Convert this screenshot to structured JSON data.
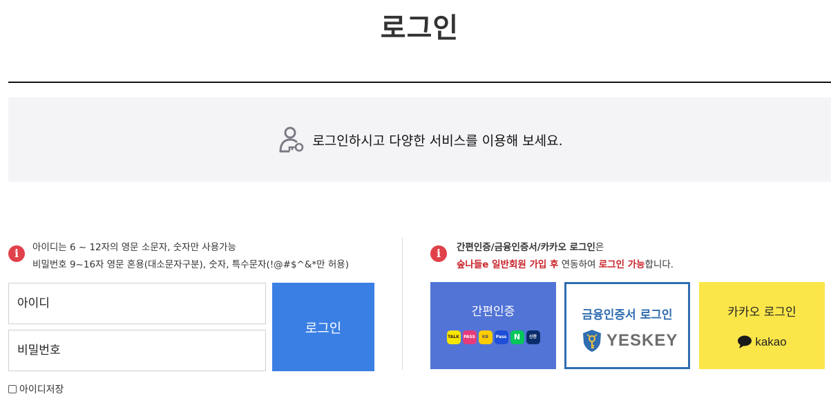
{
  "page": {
    "title": "로그인"
  },
  "banner": {
    "text": "로그인하시고 다양한 서비스를 이용해 보세요.",
    "icon": "user-key-icon"
  },
  "left_notice": {
    "line1": "아이디는 6 ~ 12자의 영문 소문자, 숫자만 사용가능",
    "line2": "비밀번호 9~16자 영문 혼용(대소문자구분), 숫자, 특수문자(!@#$^&*만 허용)"
  },
  "form": {
    "id_placeholder": "아이디",
    "pw_placeholder": "비밀번호",
    "login_label": "로그인",
    "save_id_label": "아이디저장"
  },
  "right_notice": {
    "l1_bold": "간편인증/금융인증서/카카오 로그인",
    "l1_rest": "은",
    "l2_red1": "숲나들e 일반회원 가입 후",
    "l2_mid": " 연동하여 ",
    "l2_red2": "로그인 가능",
    "l2_end": "합니다."
  },
  "cards": {
    "simple": {
      "label": "간편인증",
      "brands": [
        "TALK",
        "PASS",
        "KB",
        "Pass",
        "N",
        "신한"
      ]
    },
    "cert": {
      "label": "금융인증서 로그인",
      "logo_text": "YESKEY"
    },
    "kakao": {
      "label": "카카오 로그인",
      "logo_text": "kakao"
    }
  },
  "colors": {
    "login_button": "#3a7fe4",
    "simple_card": "#5274d6",
    "cert_border": "#2f6db0",
    "kakao_card": "#fbe64a",
    "alert_red": "#e0414a"
  }
}
